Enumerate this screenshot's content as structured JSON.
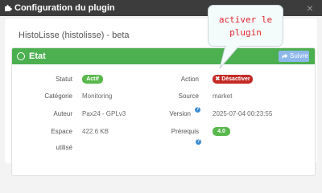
{
  "window": {
    "title": "Configuration du plugin",
    "close_icon": "close-icon"
  },
  "plugin": {
    "heading": "HistoLisse (histolisse) - beta"
  },
  "card": {
    "title": "Etat",
    "follow_label": "Suivre"
  },
  "fields": {
    "statut_label": "Statut",
    "statut_value": "Actif",
    "action_label": "Action",
    "action_value": "Désactiver",
    "categorie_label": "Catégorie",
    "categorie_value": "Monitoring",
    "source_label": "Source",
    "source_value": "market",
    "auteur_label": "Auteur",
    "auteur_value": "Pax24 - GPLv3",
    "version_label": "Version",
    "version_value": "2025-07-04 00:23:55",
    "espace_label_1": "Espace",
    "espace_label_2": "utilisé",
    "espace_value": "422.6 KB",
    "prerequis_label": "Prérequis",
    "prerequis_value": "4.0"
  },
  "annotation": {
    "line1": "activer le",
    "line2": "plugin"
  },
  "colors": {
    "card_header": "#4caf50",
    "statut_badge": "#58b84b",
    "action_badge": "#c42a25",
    "annotation_text": "#e0262d",
    "help_icon": "#3c8dd3"
  }
}
